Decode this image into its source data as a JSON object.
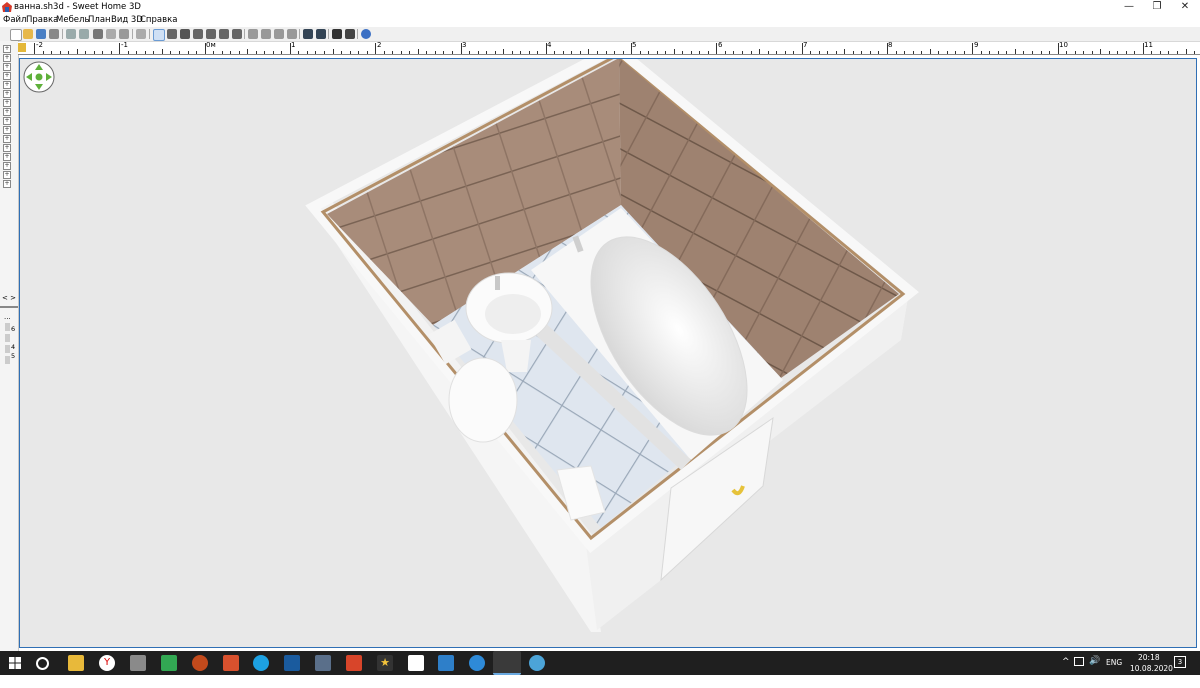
{
  "window": {
    "title": "ванна.sh3d - Sweet Home 3D",
    "controls": {
      "minimize": "—",
      "restore": "❐",
      "close": "✕"
    }
  },
  "menu": [
    "Файл",
    "Правка",
    "Мебель",
    "План",
    "Вид 3D",
    "Справка"
  ],
  "toolbar": {
    "icons": [
      "new-icon",
      "open-icon",
      "save-icon",
      "cut-prefs-icon",
      "undo-icon",
      "redo-icon",
      "cut-icon",
      "copy-icon",
      "paste-icon",
      "add-furniture-icon",
      "select-icon",
      "pan-icon",
      "create-walls-icon",
      "create-rooms-icon",
      "create-polylines-icon",
      "create-dimensions-icon",
      "add-text-icon",
      "increase-text-icon",
      "decrease-text-icon",
      "bold-icon",
      "italic-icon",
      "zoom-in-icon",
      "zoom-out-icon",
      "photo-icon",
      "video-icon",
      "help-icon"
    ]
  },
  "ruler": {
    "labels": [
      "-2",
      "-1",
      "0м",
      "1",
      "2",
      "3",
      "4",
      "5",
      "6",
      "7",
      "8",
      "9",
      "10",
      "11"
    ]
  },
  "side_panel": {
    "scroll_arrows": "< >",
    "ellipsis": "...",
    "column_numbers": [
      "6",
      "4",
      "5"
    ]
  },
  "view3d": {
    "navigation_icon": "navigation-arrows-icon"
  },
  "taskbar": {
    "apps": [
      "search-icon",
      "file-explorer-icon",
      "yandex-browser-icon",
      "media-icon",
      "camtasia-icon",
      "app-icon",
      "paint-icon",
      "skype-icon",
      "libreoffice-icon",
      "calculator-icon",
      "app-icon",
      "sticky-star-icon",
      "document-icon",
      "photos-icon",
      "network-icon",
      "sweet-home-3d-icon",
      "browser-icon"
    ],
    "tray": {
      "language": "ENG",
      "time": "20:18",
      "date": "10.08.2020",
      "notification_count": "3"
    }
  },
  "colors": {
    "accent": "#2f6fb5",
    "tile_wall": "#a68a78",
    "floor": "#dce3ec",
    "wall_white": "#f6f6f6",
    "wall_edge": "#b0906a"
  }
}
